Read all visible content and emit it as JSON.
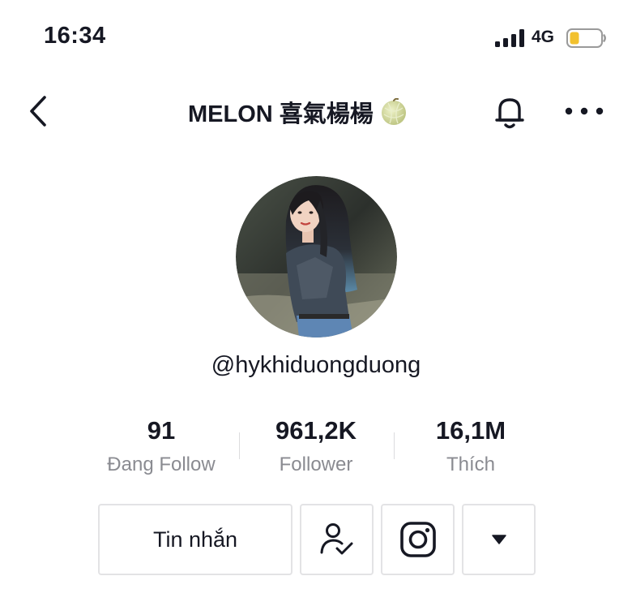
{
  "status_bar": {
    "time": "16:34",
    "network": "4G",
    "signal_icon": "cellular-signal-icon",
    "battery_icon": "battery-low-icon",
    "battery_color": "#f2c12e"
  },
  "header": {
    "title": "MELON 喜氣楊楊",
    "title_emoji_icon": "melon-icon",
    "back_icon": "chevron-left-icon",
    "bell_icon": "bell-icon",
    "more_icon": "more-horizontal-icon"
  },
  "profile": {
    "username": "@hykhiduongduong",
    "avatar_icon": "avatar-photo"
  },
  "stats": [
    {
      "value": "91",
      "label": "Đang Follow"
    },
    {
      "value": "961,2K",
      "label": "Follower"
    },
    {
      "value": "16,1M",
      "label": "Thích"
    }
  ],
  "actions": {
    "message_label": "Tin nhắn",
    "followed_icon": "user-check-icon",
    "instagram_icon": "instagram-icon",
    "dropdown_icon": "caret-down-icon"
  },
  "colors": {
    "text_primary": "#161823",
    "text_secondary": "#8a8b91",
    "border": "#e3e3e5"
  }
}
